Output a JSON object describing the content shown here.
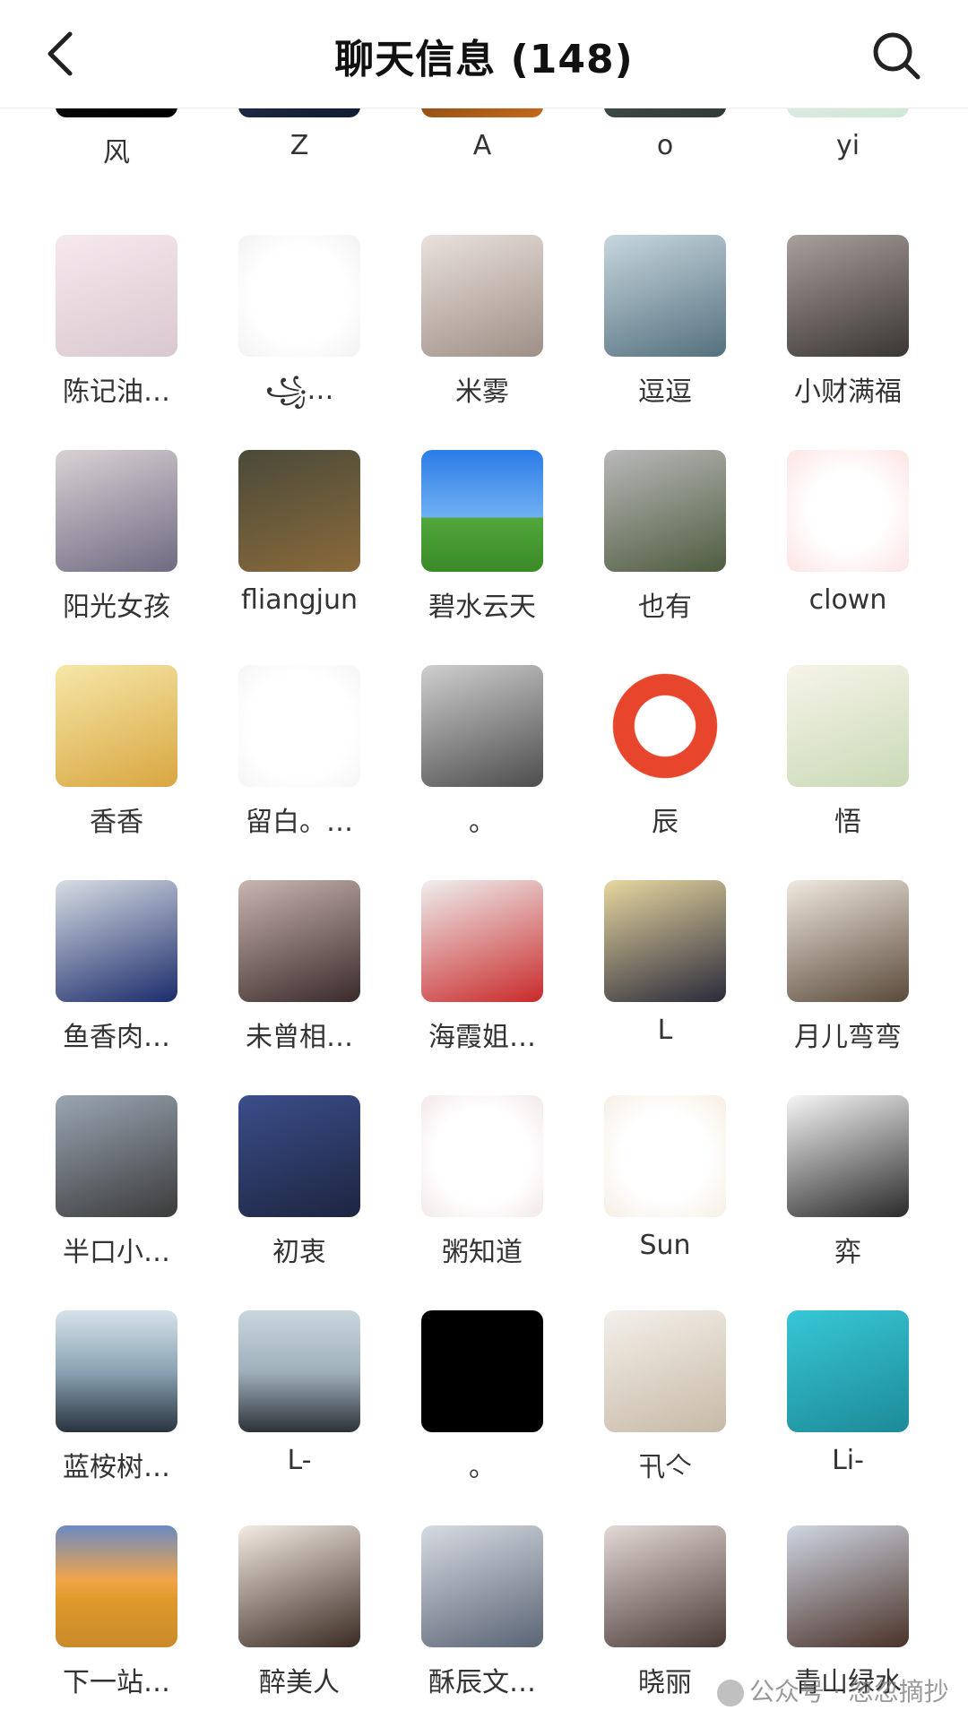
{
  "header": {
    "title": "聊天信息 (148)"
  },
  "members": [
    {
      "name": "风",
      "icon": "avatar-dark"
    },
    {
      "name": "Z",
      "icon": "avatar-jersey"
    },
    {
      "name": "A",
      "icon": "avatar-night-fire"
    },
    {
      "name": "o",
      "icon": "avatar-landscape"
    },
    {
      "name": "yi",
      "icon": "avatar-cartoon"
    },
    {
      "name": "陈记油…",
      "icon": "avatar-price-list"
    },
    {
      "name": "꧁…",
      "icon": "avatar-letter-g"
    },
    {
      "name": "米雾",
      "icon": "avatar-girl-selfie"
    },
    {
      "name": "逗逗",
      "icon": "avatar-beach"
    },
    {
      "name": "小财满福",
      "icon": "avatar-girl-car"
    },
    {
      "name": "阳光女孩",
      "icon": "avatar-girl-photo"
    },
    {
      "name": "fliangjun",
      "icon": "avatar-movie-poster"
    },
    {
      "name": "碧水云天",
      "icon": "avatar-tree-field"
    },
    {
      "name": "也有",
      "icon": "avatar-two-girls"
    },
    {
      "name": "clown",
      "icon": "avatar-clown"
    },
    {
      "name": "香香",
      "icon": "avatar-cartoon-girl"
    },
    {
      "name": "留白。…",
      "icon": "avatar-panda"
    },
    {
      "name": "。",
      "icon": "avatar-boy"
    },
    {
      "name": "辰",
      "icon": "avatar-red-seal"
    },
    {
      "name": "悟",
      "icon": "avatar-calligraphy"
    },
    {
      "name": "鱼香肉…",
      "icon": "avatar-deer-logo"
    },
    {
      "name": "未曾相…",
      "icon": "avatar-girl-filter"
    },
    {
      "name": "海霞姐…",
      "icon": "avatar-woman-red"
    },
    {
      "name": "L",
      "icon": "avatar-blond-man"
    },
    {
      "name": "月儿弯弯",
      "icon": "avatar-girl-polaroid"
    },
    {
      "name": "半口小…",
      "icon": "avatar-young-man"
    },
    {
      "name": "初衷",
      "icon": "avatar-astronaut"
    },
    {
      "name": "粥知道",
      "icon": "avatar-zhou-badge"
    },
    {
      "name": "Sun",
      "icon": "avatar-cartoon-bear"
    },
    {
      "name": "弈",
      "icon": "avatar-ink-woman"
    },
    {
      "name": "蓝桉树…",
      "icon": "avatar-sea-man"
    },
    {
      "name": "L-",
      "icon": "avatar-beach-man"
    },
    {
      "name": "。",
      "icon": "avatar-black"
    },
    {
      "name": "卂亽",
      "icon": "avatar-child-badge"
    },
    {
      "name": "Li-",
      "icon": "avatar-horse-water"
    },
    {
      "name": "下一站…",
      "icon": "avatar-fuji-sunset"
    },
    {
      "name": "醉美人",
      "icon": "avatar-painted-woman"
    },
    {
      "name": "酥辰文…",
      "icon": "avatar-anime-man"
    },
    {
      "name": "晓丽",
      "icon": "avatar-woman-hat"
    },
    {
      "name": "青山绿水",
      "icon": "avatar-middle-aged-man"
    }
  ],
  "watermark": "公众号 · 忽忽摘抄"
}
